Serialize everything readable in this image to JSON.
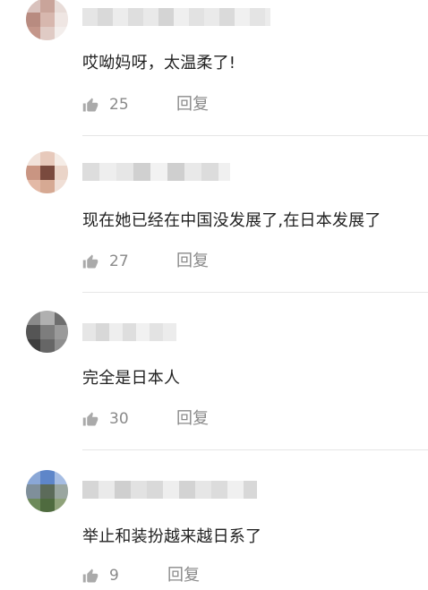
{
  "comments": [
    {
      "username": "",
      "text": "哎呦妈呀，太温柔了!",
      "likes": "25",
      "reply_label": "回复",
      "avatar_colors": [
        "#d9c2bd",
        "#c9a49a",
        "#e8dcd8",
        "#b88b80",
        "#d7b7ae",
        "#efe6e3",
        "#c4968a",
        "#e0cbc5",
        "#f3eeec"
      ],
      "username_block_colors": [
        "#e5e5e5",
        "#d9d9d9",
        "#ececec",
        "#dedede",
        "#e9e9e9",
        "#d4d4d4",
        "#efefef",
        "#e2e2e2",
        "#eaeaea",
        "#dadada",
        "#f0f0f0",
        "#e4e4e4",
        "#ececec"
      ]
    },
    {
      "username": "",
      "text": "现在她已经在中国没发展了,在日本发展了",
      "likes": "27",
      "reply_label": "回复",
      "avatar_colors": [
        "#f1e2da",
        "#e7c9bb",
        "#f5ece6",
        "#c99582",
        "#7a4a3e",
        "#ead4c8",
        "#e3b9a6",
        "#d6a993",
        "#f0dfd6"
      ],
      "username_block_colors": [
        "#dddddd",
        "#eeeeee",
        "#e6e6e6",
        "#d0d0d0",
        "#f2f2f2",
        "#cfcfcf",
        "#e9e9e9",
        "#dcdcdc",
        "#f0f0f0"
      ]
    },
    {
      "username": "",
      "text": "完全是日本人",
      "likes": "30",
      "reply_label": "回复",
      "avatar_colors": [
        "#8a8a8a",
        "#b0b0b0",
        "#6e6e6e",
        "#555555",
        "#7d7d7d",
        "#9a9a9a",
        "#3e3e3e",
        "#666666",
        "#8e8e8e"
      ],
      "username_block_colors": [
        "#e6e6e6",
        "#d8d8d8",
        "#eeeeee",
        "#dedede",
        "#f1f1f1",
        "#e3e3e3",
        "#ececec"
      ]
    },
    {
      "username": "",
      "text": "举止和装扮越来越日系了",
      "likes": "9",
      "reply_label": "回复",
      "avatar_colors": [
        "#8aa7d6",
        "#5e86c9",
        "#a6bde3",
        "#7f8f9a",
        "#5c6b5a",
        "#9aa6a0",
        "#6d8a5a",
        "#4f6b3f",
        "#8fa27a"
      ],
      "username_block_colors": [
        "#d6d6d6",
        "#eaeaea",
        "#cfcfcf",
        "#e2e2e2",
        "#d9d9d9",
        "#eeeeee",
        "#d3d3d3",
        "#e6e6e6",
        "#dcdcdc",
        "#f0f0f0",
        "#d8d8d8"
      ]
    }
  ],
  "icons": {
    "like": "thumb-up-icon"
  },
  "colors": {
    "text_primary": "#222222",
    "text_secondary": "#8a8a8a",
    "icon": "#aaaaaa",
    "divider": "#e6e6e6"
  }
}
